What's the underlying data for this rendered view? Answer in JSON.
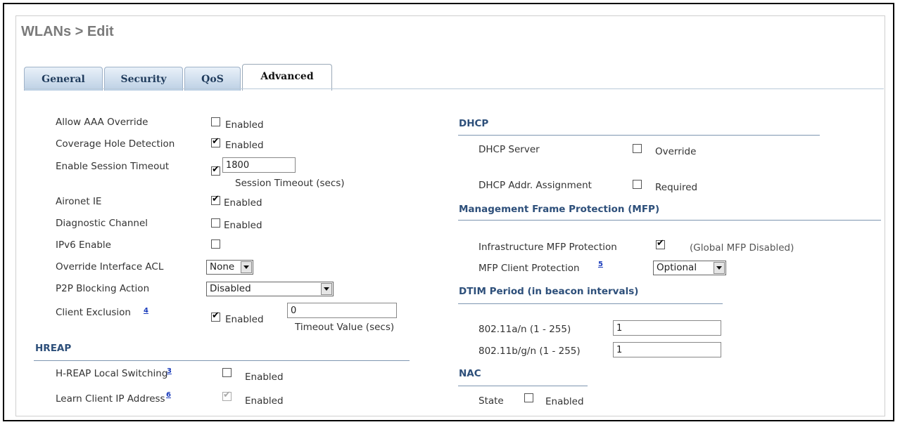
{
  "page": {
    "title": "WLANs > Edit"
  },
  "tabs": [
    {
      "label": "General",
      "active": false
    },
    {
      "label": "Security",
      "active": false
    },
    {
      "label": "QoS",
      "active": false
    },
    {
      "label": "Advanced",
      "active": true
    }
  ],
  "left": {
    "allow_aaa": {
      "label": "Allow AAA Override",
      "checked": false,
      "opt": "Enabled"
    },
    "coverage": {
      "label": "Coverage Hole Detection",
      "checked": true,
      "opt": "Enabled"
    },
    "session": {
      "label": "Enable Session Timeout",
      "checked": true,
      "value": "1800",
      "sub": "Session Timeout (secs)"
    },
    "aironet": {
      "label": "Aironet IE",
      "checked": true,
      "opt": "Enabled"
    },
    "diag": {
      "label": "Diagnostic Channel",
      "checked": false,
      "opt": "Enabled"
    },
    "ipv6": {
      "label": "IPv6 Enable",
      "checked": false
    },
    "acl": {
      "label": "Override Interface ACL",
      "value": "None"
    },
    "p2p": {
      "label": "P2P Blocking Action",
      "value": "Disabled"
    },
    "exclusion": {
      "label": "Client Exclusion",
      "footnote": "4",
      "checked": true,
      "opt": "Enabled",
      "value": "0",
      "sub": "Timeout Value (secs)"
    },
    "hreap": {
      "heading": "HREAP",
      "local": {
        "label": "H-REAP Local Switching",
        "footnote": "3",
        "checked": false,
        "opt": "Enabled"
      },
      "learn": {
        "label": "Learn Client IP Address",
        "footnote": "6",
        "checked": true,
        "disabled": true,
        "opt": "Enabled"
      }
    }
  },
  "right": {
    "dhcp": {
      "heading": "DHCP",
      "server": {
        "label": "DHCP Server",
        "checked": false,
        "opt": "Override"
      },
      "addr": {
        "label": "DHCP Addr. Assignment",
        "checked": false,
        "opt": "Required"
      }
    },
    "mfp": {
      "heading": "Management Frame Protection (MFP)",
      "infra": {
        "label": "Infrastructure MFP Protection",
        "checked": true,
        "note": "(Global MFP Disabled)"
      },
      "client": {
        "label": "MFP Client Protection",
        "footnote": "5",
        "value": "Optional"
      }
    },
    "dtim": {
      "heading": "DTIM Period (in beacon intervals)",
      "a": {
        "label": "802.11a/n (1 - 255)",
        "value": "1"
      },
      "b": {
        "label": "802.11b/g/n (1 - 255)",
        "value": "1"
      }
    },
    "nac": {
      "heading": "NAC",
      "state": {
        "label": "State",
        "checked": false,
        "opt": "Enabled"
      }
    }
  }
}
